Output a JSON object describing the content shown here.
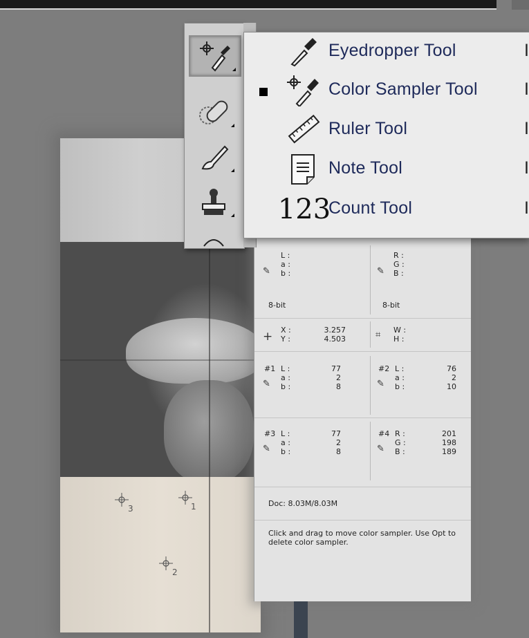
{
  "menu": {
    "items": [
      {
        "label": "Eyedropper Tool",
        "shortcut": "I",
        "icon": "eyedropper-icon",
        "selected": false
      },
      {
        "label": "Color Sampler Tool",
        "shortcut": "I",
        "icon": "color-sampler-icon",
        "selected": true
      },
      {
        "label": "Ruler Tool",
        "shortcut": "I",
        "icon": "ruler-icon",
        "selected": false
      },
      {
        "label": "Note Tool",
        "shortcut": "I",
        "icon": "note-icon",
        "selected": false
      },
      {
        "label": "Count Tool",
        "shortcut": "I",
        "icon": "count-icon",
        "selected": false,
        "glyph": "123"
      }
    ]
  },
  "toolbar": {
    "tools": [
      "color-sampler-tool",
      "healing-brush-tool",
      "brush-tool",
      "clone-stamp-tool",
      "history-brush-tool"
    ]
  },
  "info_panel": {
    "top_left": {
      "l": "L :",
      "a": "a :",
      "b": "b :",
      "depth": "8-bit"
    },
    "top_right": {
      "r": "R :",
      "g": "G :",
      "b": "B :",
      "depth": "8-bit"
    },
    "xy": {
      "x_label": "X :",
      "y_label": "Y :",
      "x_value": "3.257",
      "y_value": "4.503"
    },
    "wh": {
      "w_label": "W :",
      "h_label": "H :"
    },
    "samplers": [
      {
        "id": "#1",
        "c1": "L :",
        "c2": "a :",
        "c3": "b :",
        "v1": "77",
        "v2": "2",
        "v3": "8"
      },
      {
        "id": "#2",
        "c1": "L :",
        "c2": "a :",
        "c3": "b :",
        "v1": "76",
        "v2": "2",
        "v3": "10"
      },
      {
        "id": "#3",
        "c1": "L :",
        "c2": "a :",
        "c3": "b :",
        "v1": "77",
        "v2": "2",
        "v3": "8"
      },
      {
        "id": "#4",
        "c1": "R :",
        "c2": "G :",
        "c3": "B :",
        "v1": "201",
        "v2": "198",
        "v3": "189"
      }
    ],
    "doc": "Doc: 8.03M/8.03M",
    "help": "Click and drag to move color sampler. Use Opt to delete color sampler."
  },
  "canvas": {
    "sampler_labels": [
      "3",
      "1",
      "2"
    ]
  }
}
